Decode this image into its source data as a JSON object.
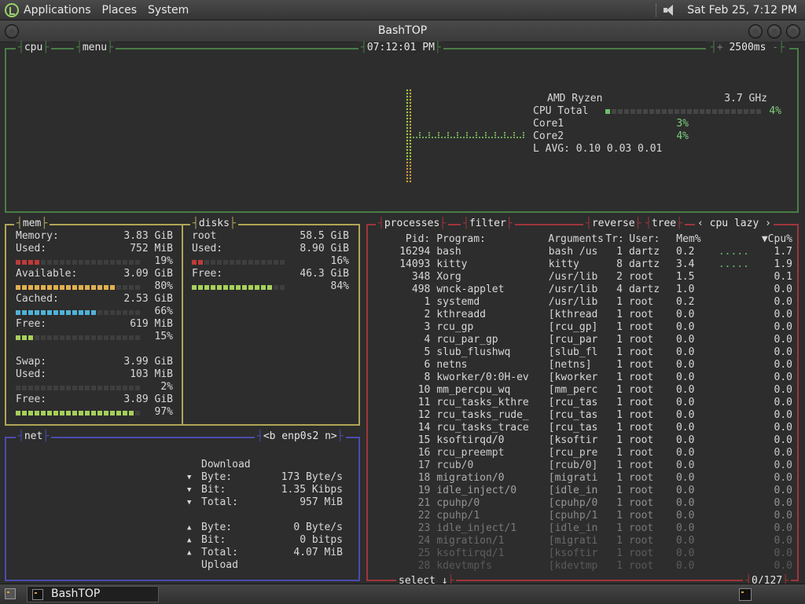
{
  "panel": {
    "menus": [
      "Applications",
      "Places",
      "System"
    ],
    "datetime": "Sat Feb 25,  7:12 PM"
  },
  "window": {
    "title": "BashTOP"
  },
  "cpu": {
    "label": "cpu",
    "menu_label": "menu",
    "clock": "07:12:01 PM",
    "plus": "+",
    "interval": "2500ms",
    "minus": "-",
    "model": "AMD Ryzen",
    "freq": "3.7 GHz",
    "total_label": "CPU Total",
    "total_pct": "4%",
    "core1_label": "Core1",
    "core1_pct": "3%",
    "core2_label": "Core2",
    "core2_pct": "4%",
    "lavg": "L AVG: 0.10 0.03 0.01",
    "total_value": 4,
    "core1_value": 3,
    "core2_value": 4
  },
  "mem": {
    "label": "mem",
    "rows": [
      {
        "name": "Memory:",
        "value": "3.83 GiB"
      },
      {
        "name": "Used:",
        "value": "752 MiB",
        "pct": "19%"
      },
      {
        "name": "Available:",
        "value": "3.09 GiB",
        "pct": "80%"
      },
      {
        "name": "Cached:",
        "value": "2.53 GiB",
        "pct": "66%"
      },
      {
        "name": "Free:",
        "value": "619 MiB",
        "pct": "15%"
      }
    ],
    "swap_rows": [
      {
        "name": "Swap:",
        "value": "3.99 GiB"
      },
      {
        "name": "Used:",
        "value": "103 MiB",
        "pct": "2%"
      },
      {
        "name": "Free:",
        "value": "3.89 GiB",
        "pct": "97%"
      }
    ],
    "used_fraction": 0.19,
    "available_fraction": 0.8,
    "cached_fraction": 0.66,
    "free_fraction": 0.15,
    "swap_used_fraction": 0.02,
    "swap_free_fraction": 0.97,
    "colors": {
      "used": "#c03a3a",
      "available": "#e0b050",
      "cached": "#4fb3d8",
      "free": "#a6d05a"
    }
  },
  "disks": {
    "label": "disks",
    "name": "root",
    "size": "58.5 GiB",
    "used_label": "Used:",
    "used": "8.90 GiB",
    "used_pct": "16%",
    "free_label": "Free:",
    "free": "46.3 GiB",
    "free_pct": "84%",
    "used_fraction": 0.16,
    "free_fraction": 0.84
  },
  "net": {
    "label": "net",
    "iface": "<b enp0s2 n>",
    "download_label": "Download",
    "upload_label": "Upload",
    "download": [
      {
        "arrow": "▼",
        "name": "Byte:",
        "value": "173 Byte/s"
      },
      {
        "arrow": "▼",
        "name": "Bit:",
        "value": "1.35 Kibps"
      },
      {
        "arrow": "▼",
        "name": "Total:",
        "value": "957 MiB"
      }
    ],
    "upload": [
      {
        "arrow": "▲",
        "name": "Byte:",
        "value": "0 Byte/s"
      },
      {
        "arrow": "▲",
        "name": "Bit:",
        "value": "0 bitps"
      },
      {
        "arrow": "▲",
        "name": "Total:",
        "value": "4.07 MiB"
      }
    ]
  },
  "proc": {
    "label": "processes",
    "filter": "filter",
    "reverse": "reverse",
    "tree": "tree",
    "sort": "‹ cpu lazy ›",
    "select": "select ↓",
    "count": "0/127",
    "headers": {
      "pid": "Pid:",
      "prog": "Program:",
      "args": "Arguments:",
      "tr": "Tr:",
      "user": "User:",
      "mem": "Mem%",
      "cpu": "▼Cpu%"
    },
    "rows": [
      {
        "pid": "16294",
        "prog": "bash",
        "args": "bash /us",
        "tr": "1",
        "user": "dartz",
        "mem": "0.2",
        "graph": ".....",
        "cpu": "1.7"
      },
      {
        "pid": "14093",
        "prog": "kitty",
        "args": "kitty",
        "tr": "8",
        "user": "dartz",
        "mem": "3.4",
        "graph": ".....",
        "cpu": "1.9"
      },
      {
        "pid": "348",
        "prog": "Xorg",
        "args": "/usr/lib",
        "tr": "2",
        "user": "root",
        "mem": "1.5",
        "graph": "",
        "cpu": "0.1"
      },
      {
        "pid": "498",
        "prog": "wnck-applet",
        "args": "/usr/lib",
        "tr": "4",
        "user": "dartz",
        "mem": "1.0",
        "graph": "",
        "cpu": "0.0"
      },
      {
        "pid": "1",
        "prog": "systemd",
        "args": "/usr/lib",
        "tr": "1",
        "user": "root",
        "mem": "0.2",
        "graph": "",
        "cpu": "0.0"
      },
      {
        "pid": "2",
        "prog": "kthreadd",
        "args": "[kthread",
        "tr": "1",
        "user": "root",
        "mem": "0.0",
        "graph": "",
        "cpu": "0.0"
      },
      {
        "pid": "3",
        "prog": "rcu_gp",
        "args": "[rcu_gp]",
        "tr": "1",
        "user": "root",
        "mem": "0.0",
        "graph": "",
        "cpu": "0.0"
      },
      {
        "pid": "4",
        "prog": "rcu_par_gp",
        "args": "[rcu_par",
        "tr": "1",
        "user": "root",
        "mem": "0.0",
        "graph": "",
        "cpu": "0.0"
      },
      {
        "pid": "5",
        "prog": "slub_flushwq",
        "args": "[slub_fl",
        "tr": "1",
        "user": "root",
        "mem": "0.0",
        "graph": "",
        "cpu": "0.0"
      },
      {
        "pid": "6",
        "prog": "netns",
        "args": "[netns]",
        "tr": "1",
        "user": "root",
        "mem": "0.0",
        "graph": "",
        "cpu": "0.0"
      },
      {
        "pid": "8",
        "prog": "kworker/0:0H-ev",
        "args": "[kworker",
        "tr": "1",
        "user": "root",
        "mem": "0.0",
        "graph": "",
        "cpu": "0.0"
      },
      {
        "pid": "10",
        "prog": "mm_percpu_wq",
        "args": "[mm_perc",
        "tr": "1",
        "user": "root",
        "mem": "0.0",
        "graph": "",
        "cpu": "0.0"
      },
      {
        "pid": "11",
        "prog": "rcu_tasks_kthre",
        "args": "[rcu_tas",
        "tr": "1",
        "user": "root",
        "mem": "0.0",
        "graph": "",
        "cpu": "0.0"
      },
      {
        "pid": "12",
        "prog": "rcu_tasks_rude_",
        "args": "[rcu_tas",
        "tr": "1",
        "user": "root",
        "mem": "0.0",
        "graph": "",
        "cpu": "0.0"
      },
      {
        "pid": "14",
        "prog": "rcu_tasks_trace",
        "args": "[rcu_tas",
        "tr": "1",
        "user": "root",
        "mem": "0.0",
        "graph": "",
        "cpu": "0.0"
      },
      {
        "pid": "15",
        "prog": "ksoftirqd/0",
        "args": "[ksoftir",
        "tr": "1",
        "user": "root",
        "mem": "0.0",
        "graph": "",
        "cpu": "0.0"
      },
      {
        "pid": "16",
        "prog": "rcu_preempt",
        "args": "[rcu_pre",
        "tr": "1",
        "user": "root",
        "mem": "0.0",
        "graph": "",
        "cpu": "0.0"
      },
      {
        "pid": "17",
        "prog": "rcub/0",
        "args": "[rcub/0]",
        "tr": "1",
        "user": "root",
        "mem": "0.0",
        "graph": "",
        "cpu": "0.0"
      },
      {
        "pid": "18",
        "prog": "migration/0",
        "args": "[migrati",
        "tr": "1",
        "user": "root",
        "mem": "0.0",
        "graph": "",
        "cpu": "0.0"
      },
      {
        "pid": "19",
        "prog": "idle_inject/0",
        "args": "[idle_in",
        "tr": "1",
        "user": "root",
        "mem": "0.0",
        "graph": "",
        "cpu": "0.0"
      },
      {
        "pid": "21",
        "prog": "cpuhp/0",
        "args": "[cpuhp/0",
        "tr": "1",
        "user": "root",
        "mem": "0.0",
        "graph": "",
        "cpu": "0.0"
      },
      {
        "pid": "22",
        "prog": "cpuhp/1",
        "args": "[cpuhp/1",
        "tr": "1",
        "user": "root",
        "mem": "0.0",
        "graph": "",
        "cpu": "0.0"
      },
      {
        "pid": "23",
        "prog": "idle_inject/1",
        "args": "[idle_in",
        "tr": "1",
        "user": "root",
        "mem": "0.0",
        "graph": "",
        "cpu": "0.0"
      },
      {
        "pid": "24",
        "prog": "migration/1",
        "args": "[migrati",
        "tr": "1",
        "user": "root",
        "mem": "0.0",
        "graph": "",
        "cpu": "0.0"
      },
      {
        "pid": "25",
        "prog": "ksoftirqd/1",
        "args": "[ksoftir",
        "tr": "1",
        "user": "root",
        "mem": "0.0",
        "graph": "",
        "cpu": "0.0"
      },
      {
        "pid": "28",
        "prog": "kdevtmpfs",
        "args": "[kdevtmp",
        "tr": "1",
        "user": "root",
        "mem": "0.0",
        "graph": "",
        "cpu": "0.0"
      }
    ]
  },
  "taskbar": {
    "task": "BashTOP"
  }
}
